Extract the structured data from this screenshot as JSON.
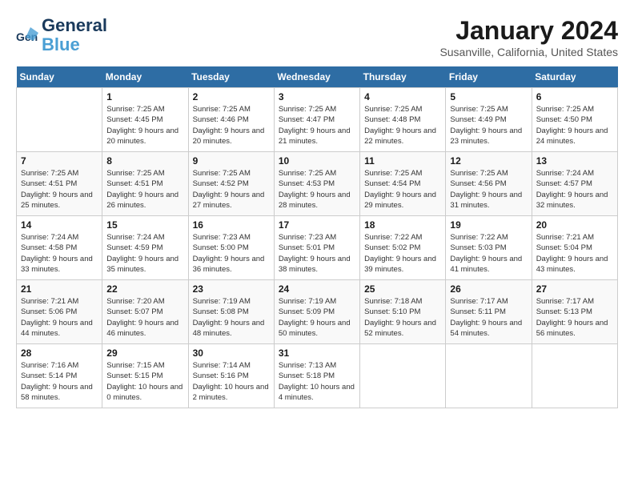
{
  "app": {
    "name_part1": "General",
    "name_part2": "Blue"
  },
  "header": {
    "title": "January 2024",
    "location": "Susanville, California, United States"
  },
  "weekdays": [
    "Sunday",
    "Monday",
    "Tuesday",
    "Wednesday",
    "Thursday",
    "Friday",
    "Saturday"
  ],
  "weeks": [
    [
      {
        "day": "",
        "sunrise": "",
        "sunset": "",
        "daylight": ""
      },
      {
        "day": "1",
        "sunrise": "Sunrise: 7:25 AM",
        "sunset": "Sunset: 4:45 PM",
        "daylight": "Daylight: 9 hours and 20 minutes."
      },
      {
        "day": "2",
        "sunrise": "Sunrise: 7:25 AM",
        "sunset": "Sunset: 4:46 PM",
        "daylight": "Daylight: 9 hours and 20 minutes."
      },
      {
        "day": "3",
        "sunrise": "Sunrise: 7:25 AM",
        "sunset": "Sunset: 4:47 PM",
        "daylight": "Daylight: 9 hours and 21 minutes."
      },
      {
        "day": "4",
        "sunrise": "Sunrise: 7:25 AM",
        "sunset": "Sunset: 4:48 PM",
        "daylight": "Daylight: 9 hours and 22 minutes."
      },
      {
        "day": "5",
        "sunrise": "Sunrise: 7:25 AM",
        "sunset": "Sunset: 4:49 PM",
        "daylight": "Daylight: 9 hours and 23 minutes."
      },
      {
        "day": "6",
        "sunrise": "Sunrise: 7:25 AM",
        "sunset": "Sunset: 4:50 PM",
        "daylight": "Daylight: 9 hours and 24 minutes."
      }
    ],
    [
      {
        "day": "7",
        "sunrise": "Sunrise: 7:25 AM",
        "sunset": "Sunset: 4:51 PM",
        "daylight": "Daylight: 9 hours and 25 minutes."
      },
      {
        "day": "8",
        "sunrise": "Sunrise: 7:25 AM",
        "sunset": "Sunset: 4:51 PM",
        "daylight": "Daylight: 9 hours and 26 minutes."
      },
      {
        "day": "9",
        "sunrise": "Sunrise: 7:25 AM",
        "sunset": "Sunset: 4:52 PM",
        "daylight": "Daylight: 9 hours and 27 minutes."
      },
      {
        "day": "10",
        "sunrise": "Sunrise: 7:25 AM",
        "sunset": "Sunset: 4:53 PM",
        "daylight": "Daylight: 9 hours and 28 minutes."
      },
      {
        "day": "11",
        "sunrise": "Sunrise: 7:25 AM",
        "sunset": "Sunset: 4:54 PM",
        "daylight": "Daylight: 9 hours and 29 minutes."
      },
      {
        "day": "12",
        "sunrise": "Sunrise: 7:25 AM",
        "sunset": "Sunset: 4:56 PM",
        "daylight": "Daylight: 9 hours and 31 minutes."
      },
      {
        "day": "13",
        "sunrise": "Sunrise: 7:24 AM",
        "sunset": "Sunset: 4:57 PM",
        "daylight": "Daylight: 9 hours and 32 minutes."
      }
    ],
    [
      {
        "day": "14",
        "sunrise": "Sunrise: 7:24 AM",
        "sunset": "Sunset: 4:58 PM",
        "daylight": "Daylight: 9 hours and 33 minutes."
      },
      {
        "day": "15",
        "sunrise": "Sunrise: 7:24 AM",
        "sunset": "Sunset: 4:59 PM",
        "daylight": "Daylight: 9 hours and 35 minutes."
      },
      {
        "day": "16",
        "sunrise": "Sunrise: 7:23 AM",
        "sunset": "Sunset: 5:00 PM",
        "daylight": "Daylight: 9 hours and 36 minutes."
      },
      {
        "day": "17",
        "sunrise": "Sunrise: 7:23 AM",
        "sunset": "Sunset: 5:01 PM",
        "daylight": "Daylight: 9 hours and 38 minutes."
      },
      {
        "day": "18",
        "sunrise": "Sunrise: 7:22 AM",
        "sunset": "Sunset: 5:02 PM",
        "daylight": "Daylight: 9 hours and 39 minutes."
      },
      {
        "day": "19",
        "sunrise": "Sunrise: 7:22 AM",
        "sunset": "Sunset: 5:03 PM",
        "daylight": "Daylight: 9 hours and 41 minutes."
      },
      {
        "day": "20",
        "sunrise": "Sunrise: 7:21 AM",
        "sunset": "Sunset: 5:04 PM",
        "daylight": "Daylight: 9 hours and 43 minutes."
      }
    ],
    [
      {
        "day": "21",
        "sunrise": "Sunrise: 7:21 AM",
        "sunset": "Sunset: 5:06 PM",
        "daylight": "Daylight: 9 hours and 44 minutes."
      },
      {
        "day": "22",
        "sunrise": "Sunrise: 7:20 AM",
        "sunset": "Sunset: 5:07 PM",
        "daylight": "Daylight: 9 hours and 46 minutes."
      },
      {
        "day": "23",
        "sunrise": "Sunrise: 7:19 AM",
        "sunset": "Sunset: 5:08 PM",
        "daylight": "Daylight: 9 hours and 48 minutes."
      },
      {
        "day": "24",
        "sunrise": "Sunrise: 7:19 AM",
        "sunset": "Sunset: 5:09 PM",
        "daylight": "Daylight: 9 hours and 50 minutes."
      },
      {
        "day": "25",
        "sunrise": "Sunrise: 7:18 AM",
        "sunset": "Sunset: 5:10 PM",
        "daylight": "Daylight: 9 hours and 52 minutes."
      },
      {
        "day": "26",
        "sunrise": "Sunrise: 7:17 AM",
        "sunset": "Sunset: 5:11 PM",
        "daylight": "Daylight: 9 hours and 54 minutes."
      },
      {
        "day": "27",
        "sunrise": "Sunrise: 7:17 AM",
        "sunset": "Sunset: 5:13 PM",
        "daylight": "Daylight: 9 hours and 56 minutes."
      }
    ],
    [
      {
        "day": "28",
        "sunrise": "Sunrise: 7:16 AM",
        "sunset": "Sunset: 5:14 PM",
        "daylight": "Daylight: 9 hours and 58 minutes."
      },
      {
        "day": "29",
        "sunrise": "Sunrise: 7:15 AM",
        "sunset": "Sunset: 5:15 PM",
        "daylight": "Daylight: 10 hours and 0 minutes."
      },
      {
        "day": "30",
        "sunrise": "Sunrise: 7:14 AM",
        "sunset": "Sunset: 5:16 PM",
        "daylight": "Daylight: 10 hours and 2 minutes."
      },
      {
        "day": "31",
        "sunrise": "Sunrise: 7:13 AM",
        "sunset": "Sunset: 5:18 PM",
        "daylight": "Daylight: 10 hours and 4 minutes."
      },
      {
        "day": "",
        "sunrise": "",
        "sunset": "",
        "daylight": ""
      },
      {
        "day": "",
        "sunrise": "",
        "sunset": "",
        "daylight": ""
      },
      {
        "day": "",
        "sunrise": "",
        "sunset": "",
        "daylight": ""
      }
    ]
  ]
}
